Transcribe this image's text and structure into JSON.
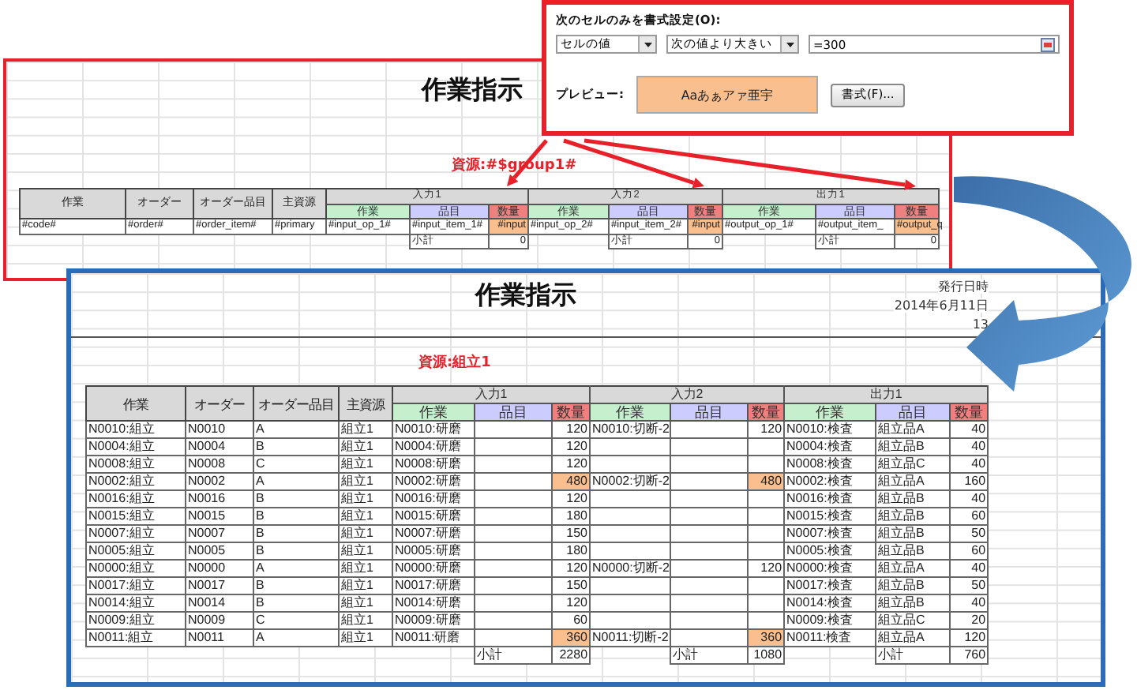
{
  "format_dialog": {
    "label": "次のセルのみを書式設定(O):",
    "condition_type": "セルの値",
    "operator": "次の値より大きい",
    "value": "=300",
    "preview_label": "プレビュー:",
    "preview_text": "Aaあぁアァ亜宇",
    "format_button": "書式(F)..."
  },
  "template_sheet": {
    "title": "作業指示",
    "resource_label": "資源:#$group1#",
    "table": {
      "columns": [
        "作業",
        "オーダー",
        "オーダー品目",
        "主資源"
      ],
      "groups": [
        {
          "title": "入力1",
          "columns": [
            "作業",
            "品目",
            "数量"
          ],
          "subtotal_label": "小計",
          "subtotal": "0"
        },
        {
          "title": "入力2",
          "columns": [
            "作業",
            "品目",
            "数量"
          ],
          "subtotal_label": "小計",
          "subtotal": "0"
        },
        {
          "title": "出力1",
          "columns": [
            "作業",
            "品目",
            "数量"
          ],
          "subtotal_label": "小計",
          "subtotal": "0"
        }
      ],
      "rows": [
        {
          "cells": [
            "#code#",
            "#order#",
            "#order_item#",
            "#primary"
          ],
          "groups": [
            {
              "op": "#input_op_1#",
              "item": "#input_item_1#",
              "qty": "#input",
              "highlighted": true
            },
            {
              "op": "#input_op_2#",
              "item": "#input_item_2#",
              "qty": "#input",
              "highlighted": true
            },
            {
              "op": "#output_op_1#",
              "item": "#output_item_",
              "qty": "#output_q",
              "highlighted": true
            }
          ]
        }
      ]
    }
  },
  "result_sheet": {
    "title": "作業指示",
    "issued_label": "発行日時",
    "issued_date": "2014年6月11日",
    "issued_time": "13",
    "resource_label": "資源:組立1",
    "table": {
      "columns": [
        "作業",
        "オーダー",
        "オーダー品目",
        "主資源"
      ],
      "groups": [
        {
          "title": "入力1",
          "columns": [
            "作業",
            "品目",
            "数量"
          ],
          "subtotal_label": "小計",
          "subtotal": "2280"
        },
        {
          "title": "入力2",
          "columns": [
            "作業",
            "品目",
            "数量"
          ],
          "subtotal_label": "小計",
          "subtotal": "1080"
        },
        {
          "title": "出力1",
          "columns": [
            "作業",
            "品目",
            "数量"
          ],
          "subtotal_label": "小計",
          "subtotal": "760"
        }
      ],
      "rows": [
        {
          "cells": [
            "N0010:組立",
            "N0010",
            "A",
            "組立1"
          ],
          "groups": [
            {
              "op": "N0010:研磨",
              "qty": "120",
              "highlighted": false
            },
            {
              "op": "N0010:切断-2",
              "qty": "120",
              "highlighted": false
            },
            {
              "op": "N0010:検査",
              "item": "組立品A",
              "qty": "40",
              "highlighted": false
            }
          ]
        },
        {
          "cells": [
            "N0004:組立",
            "N0004",
            "B",
            "組立1"
          ],
          "groups": [
            {
              "op": "N0004:研磨",
              "qty": "120",
              "highlighted": false
            },
            {
              "highlighted": false
            },
            {
              "op": "N0004:検査",
              "item": "組立品B",
              "qty": "40",
              "highlighted": false
            }
          ]
        },
        {
          "cells": [
            "N0008:組立",
            "N0008",
            "C",
            "組立1"
          ],
          "groups": [
            {
              "op": "N0008:研磨",
              "qty": "120",
              "highlighted": false
            },
            {
              "highlighted": false
            },
            {
              "op": "N0008:検査",
              "item": "組立品C",
              "qty": "40",
              "highlighted": false
            }
          ]
        },
        {
          "cells": [
            "N0002:組立",
            "N0002",
            "A",
            "組立1"
          ],
          "groups": [
            {
              "op": "N0002:研磨",
              "qty": "480",
              "highlighted": true
            },
            {
              "op": "N0002:切断-2",
              "qty": "480",
              "highlighted": true
            },
            {
              "op": "N0002:検査",
              "item": "組立品A",
              "qty": "160",
              "highlighted": false
            }
          ]
        },
        {
          "cells": [
            "N0016:組立",
            "N0016",
            "B",
            "組立1"
          ],
          "groups": [
            {
              "op": "N0016:研磨",
              "qty": "120",
              "highlighted": false
            },
            {
              "highlighted": false
            },
            {
              "op": "N0016:検査",
              "item": "組立品B",
              "qty": "40",
              "highlighted": false
            }
          ]
        },
        {
          "cells": [
            "N0015:組立",
            "N0015",
            "B",
            "組立1"
          ],
          "groups": [
            {
              "op": "N0015:研磨",
              "qty": "180",
              "highlighted": false
            },
            {
              "highlighted": false
            },
            {
              "op": "N0015:検査",
              "item": "組立品B",
              "qty": "60",
              "highlighted": false
            }
          ]
        },
        {
          "cells": [
            "N0007:組立",
            "N0007",
            "B",
            "組立1"
          ],
          "groups": [
            {
              "op": "N0007:研磨",
              "qty": "150",
              "highlighted": false
            },
            {
              "highlighted": false
            },
            {
              "op": "N0007:検査",
              "item": "組立品B",
              "qty": "50",
              "highlighted": false
            }
          ]
        },
        {
          "cells": [
            "N0005:組立",
            "N0005",
            "B",
            "組立1"
          ],
          "groups": [
            {
              "op": "N0005:研磨",
              "qty": "180",
              "highlighted": false
            },
            {
              "highlighted": false
            },
            {
              "op": "N0005:検査",
              "item": "組立品B",
              "qty": "60",
              "highlighted": false
            }
          ]
        },
        {
          "cells": [
            "N0000:組立",
            "N0000",
            "A",
            "組立1"
          ],
          "groups": [
            {
              "op": "N0000:研磨",
              "qty": "120",
              "highlighted": false
            },
            {
              "op": "N0000:切断-2",
              "qty": "120",
              "highlighted": false
            },
            {
              "op": "N0000:検査",
              "item": "組立品A",
              "qty": "40",
              "highlighted": false
            }
          ]
        },
        {
          "cells": [
            "N0017:組立",
            "N0017",
            "B",
            "組立1"
          ],
          "groups": [
            {
              "op": "N0017:研磨",
              "qty": "150",
              "highlighted": false
            },
            {
              "highlighted": false
            },
            {
              "op": "N0017:検査",
              "item": "組立品B",
              "qty": "50",
              "highlighted": false
            }
          ]
        },
        {
          "cells": [
            "N0014:組立",
            "N0014",
            "B",
            "組立1"
          ],
          "groups": [
            {
              "op": "N0014:研磨",
              "qty": "120",
              "highlighted": false
            },
            {
              "highlighted": false
            },
            {
              "op": "N0014:検査",
              "item": "組立品B",
              "qty": "40",
              "highlighted": false
            }
          ]
        },
        {
          "cells": [
            "N0009:組立",
            "N0009",
            "C",
            "組立1"
          ],
          "groups": [
            {
              "op": "N0009:研磨",
              "qty": "60",
              "highlighted": false
            },
            {
              "highlighted": false
            },
            {
              "op": "N0009:検査",
              "item": "組立品C",
              "qty": "20",
              "highlighted": false
            }
          ]
        },
        {
          "cells": [
            "N0011:組立",
            "N0011",
            "A",
            "組立1"
          ],
          "groups": [
            {
              "op": "N0011:研磨",
              "qty": "360",
              "highlighted": true
            },
            {
              "op": "N0011:切断-2",
              "qty": "360",
              "highlighted": true
            },
            {
              "op": "N0011:検査",
              "item": "組立品A",
              "qty": "120",
              "highlighted": false
            }
          ]
        }
      ]
    }
  }
}
